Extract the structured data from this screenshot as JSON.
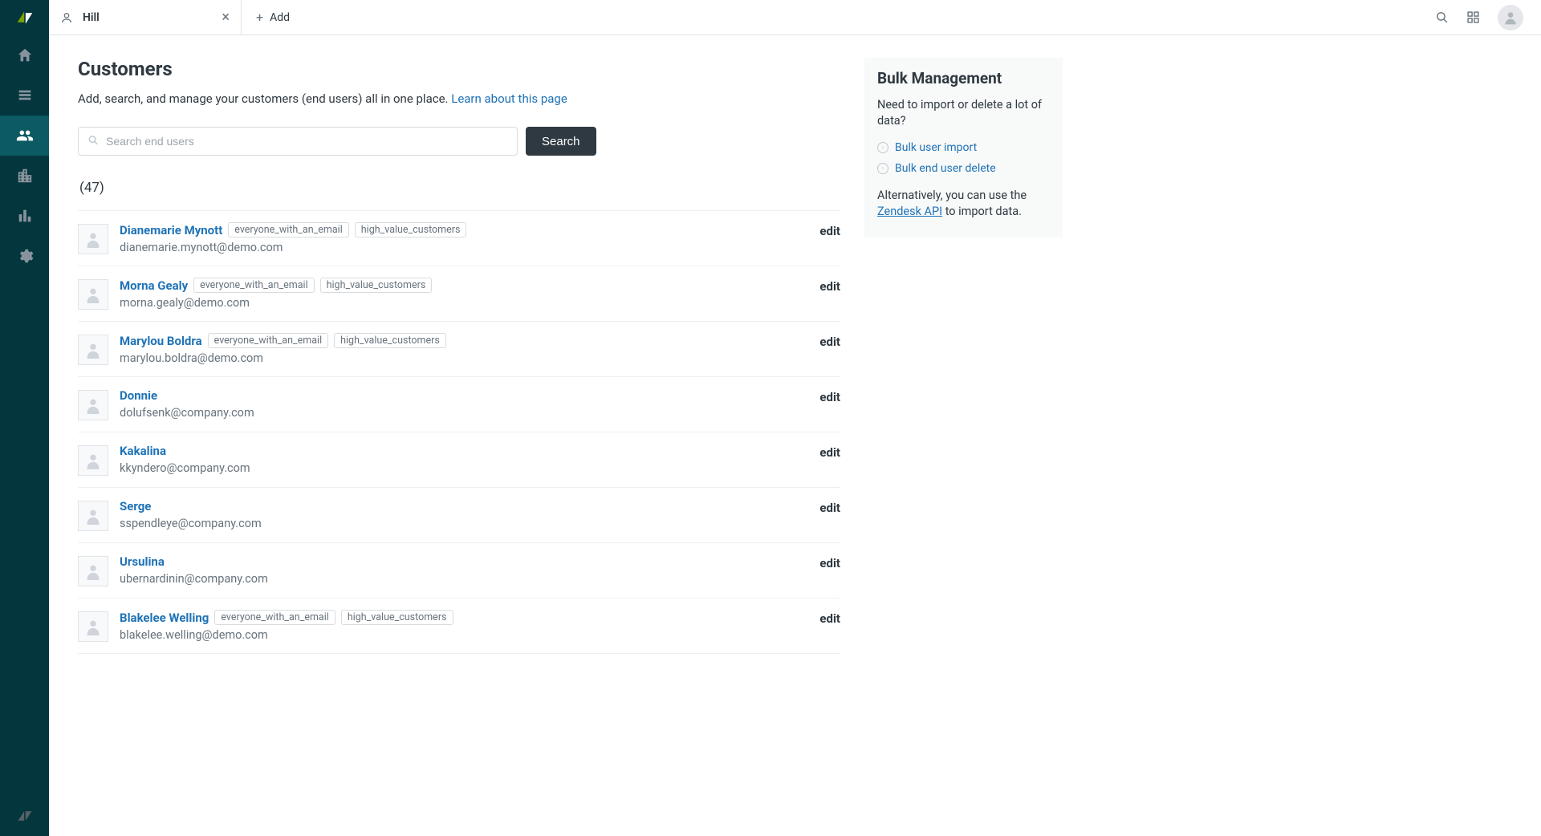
{
  "tab": {
    "label": "Hill"
  },
  "add_tab": {
    "label": "Add"
  },
  "page": {
    "title": "Customers",
    "subtitle": "Add, search, and manage your customers (end users) all in one place. ",
    "learn_link": "Learn about this page"
  },
  "search": {
    "placeholder": "Search end users",
    "button": "Search"
  },
  "count": "(47)",
  "edit_label": "edit",
  "users": [
    {
      "name": "Dianemarie Mynott",
      "email": "dianemarie.mynott@demo.com",
      "tags": [
        "everyone_with_an_email",
        "high_value_customers"
      ]
    },
    {
      "name": "Morna Gealy",
      "email": "morna.gealy@demo.com",
      "tags": [
        "everyone_with_an_email",
        "high_value_customers"
      ]
    },
    {
      "name": "Marylou Boldra",
      "email": "marylou.boldra@demo.com",
      "tags": [
        "everyone_with_an_email",
        "high_value_customers"
      ]
    },
    {
      "name": "Donnie",
      "email": "dolufsenk@company.com",
      "tags": []
    },
    {
      "name": "Kakalina",
      "email": "kkyndero@company.com",
      "tags": []
    },
    {
      "name": "Serge",
      "email": "sspendleye@company.com",
      "tags": []
    },
    {
      "name": "Ursulina",
      "email": "ubernardinin@company.com",
      "tags": []
    },
    {
      "name": "Blakelee Welling",
      "email": "blakelee.welling@demo.com",
      "tags": [
        "everyone_with_an_email",
        "high_value_customers"
      ]
    }
  ],
  "bulk": {
    "title": "Bulk Management",
    "desc": "Need to import or delete a lot of data?",
    "import": "Bulk user import",
    "delete": "Bulk end user delete",
    "alt_pre": "Alternatively, you can use the ",
    "alt_link": "Zendesk API",
    "alt_post": " to import data."
  }
}
